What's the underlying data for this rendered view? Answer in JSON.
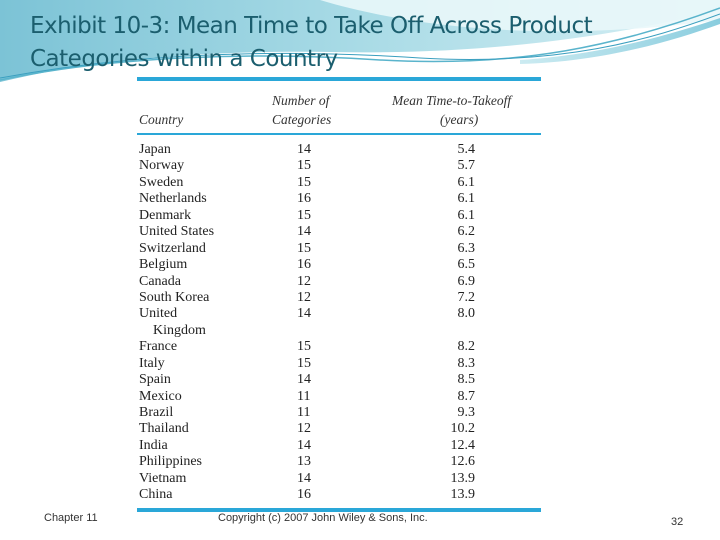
{
  "slide": {
    "title": "Exhibit 10-3: Mean Time to Take Off Across Product Categories within a Country"
  },
  "table": {
    "headers": {
      "country": "Country",
      "categories_line1": "Number of",
      "categories_line2": "Categories",
      "mean_line1": "Mean Time-to-Takeoff",
      "mean_line2": "(years)"
    },
    "rows": [
      {
        "country": "Japan",
        "categories": "14",
        "mean": "5.4"
      },
      {
        "country": "Norway",
        "categories": "15",
        "mean": "5.7"
      },
      {
        "country": "Sweden",
        "categories": "15",
        "mean": "6.1"
      },
      {
        "country": "Netherlands",
        "categories": "16",
        "mean": "6.1"
      },
      {
        "country": "Denmark",
        "categories": "15",
        "mean": "6.1"
      },
      {
        "country": "United States",
        "categories": "14",
        "mean": "6.2"
      },
      {
        "country": "Switzerland",
        "categories": "15",
        "mean": "6.3"
      },
      {
        "country": "Belgium",
        "categories": "16",
        "mean": "6.5"
      },
      {
        "country": "Canada",
        "categories": "12",
        "mean": "6.9"
      },
      {
        "country": "South Korea",
        "categories": "12",
        "mean": "7.2"
      },
      {
        "country": "United",
        "country_cont": "Kingdom",
        "categories": "14",
        "mean": "8.0"
      },
      {
        "country": "France",
        "categories": "15",
        "mean": "8.2"
      },
      {
        "country": "Italy",
        "categories": "15",
        "mean": "8.3"
      },
      {
        "country": "Spain",
        "categories": "14",
        "mean": "8.5"
      },
      {
        "country": "Mexico",
        "categories": "11",
        "mean": "8.7"
      },
      {
        "country": "Brazil",
        "categories": "11",
        "mean": "9.3"
      },
      {
        "country": "Thailand",
        "categories": "12",
        "mean": "10.2"
      },
      {
        "country": "India",
        "categories": "14",
        "mean": "12.4"
      },
      {
        "country": "Philippines",
        "categories": "13",
        "mean": "12.6"
      },
      {
        "country": "Vietnam",
        "categories": "14",
        "mean": "13.9"
      },
      {
        "country": "China",
        "categories": "16",
        "mean": "13.9"
      }
    ]
  },
  "footer": {
    "chapter": "Chapter 11",
    "copyright": "Copyright (c) 2007 John Wiley & Sons, Inc.",
    "page_number": "32"
  },
  "colors": {
    "accent": "#2aa7d8",
    "title": "#1b5e6e"
  }
}
